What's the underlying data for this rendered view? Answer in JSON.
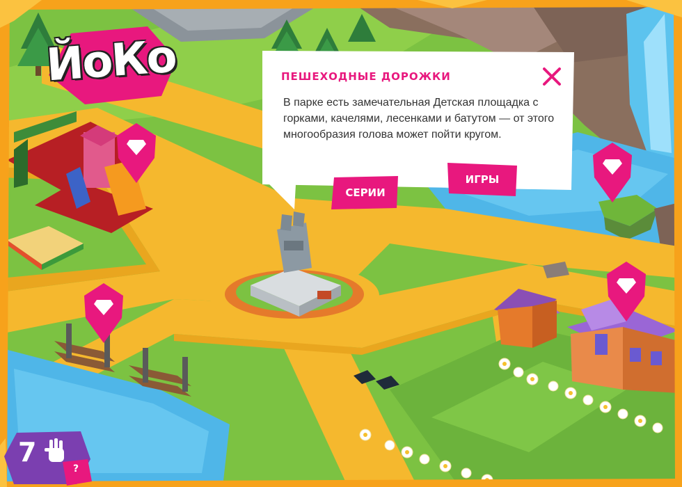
{
  "app": {
    "logo_text": "ЙоКо"
  },
  "popup": {
    "title": "Пешеходные дорожки",
    "body": "В парке есть замечательная Детская площадка с горками, качелями, лесенками и батутом — от этого многообразия голова может пойти кругом.",
    "series_button": "Серии",
    "games_button": "Игры"
  },
  "counter": {
    "value": "7",
    "help": "?"
  },
  "colors": {
    "accent": "#e8187e",
    "grass": "#7cc242",
    "path": "#f5b82e",
    "water": "#4fb6e8",
    "frame": "#f7a21b"
  },
  "icons": [
    "close-icon",
    "map-pin-icon",
    "hand-icon",
    "help-icon"
  ]
}
